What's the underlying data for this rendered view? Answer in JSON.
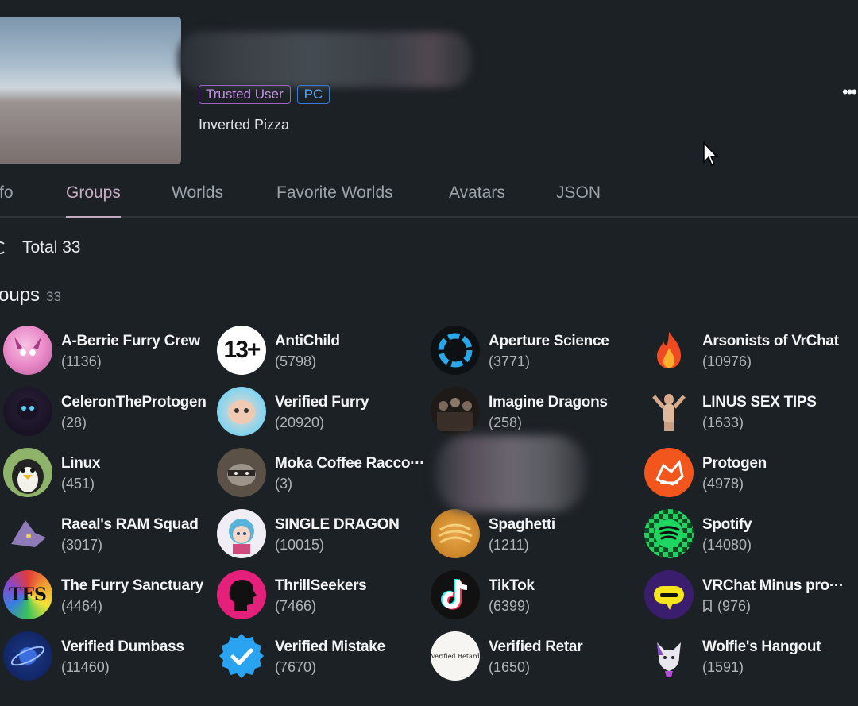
{
  "profile": {
    "badges": [
      "Trusted User",
      "PC"
    ],
    "status": "Inverted Pizza",
    "more_icon": "ellipsis-icon"
  },
  "tabs": [
    {
      "label": "Info",
      "visible": "fo"
    },
    {
      "label": "Groups",
      "visible": "Groups",
      "active": true
    },
    {
      "label": "Worlds",
      "visible": "Worlds"
    },
    {
      "label": "Favorite Worlds",
      "visible": "Favorite Worlds"
    },
    {
      "label": "Avatars",
      "visible": "Avatars"
    },
    {
      "label": "JSON",
      "visible": "JSON"
    }
  ],
  "summary": {
    "total_label": "Total 33"
  },
  "section": {
    "title": "roups",
    "count": "33"
  },
  "groups": [
    {
      "name": "A-Berrie Furry Crew",
      "count": "(1136)"
    },
    {
      "name": "AntiChild",
      "count": "(5798)"
    },
    {
      "name": "Aperture Science",
      "count": "(3771)"
    },
    {
      "name": "Arsonists of VrChat",
      "count": "(10976)"
    },
    {
      "name": "CeleronTheProtogen",
      "count": "(28)"
    },
    {
      "name": "Verified Furry",
      "count": "(20920)"
    },
    {
      "name": "Imagine Dragons",
      "count": "(258)"
    },
    {
      "name": "LINUS SEX TIPS",
      "count": "(1633)"
    },
    {
      "name": "Linux",
      "count": "(451)"
    },
    {
      "name": "Moka Coffee Racco···",
      "count": "(3)"
    },
    {
      "name": "",
      "count": ""
    },
    {
      "name": "Protogen",
      "count": "(4978)"
    },
    {
      "name": "Raeal's RAM Squad",
      "count": "(3017)"
    },
    {
      "name": "SINGLE DRAGON",
      "count": "(10015)"
    },
    {
      "name": "Spaghetti",
      "count": "(1211)"
    },
    {
      "name": "Spotify",
      "count": "(14080)"
    },
    {
      "name": "The Furry Sanctuary",
      "count": "(4464)"
    },
    {
      "name": "ThrillSeekers",
      "count": "(7466)"
    },
    {
      "name": "TikTok",
      "count": "(6399)"
    },
    {
      "name": "VRChat Minus pro···",
      "count": "(976)"
    },
    {
      "name": "Verified Dumbass",
      "count": "(11460)"
    },
    {
      "name": "Verified Mistake",
      "count": "(7670)"
    },
    {
      "name": "Verified Retar",
      "count": "(1650)"
    },
    {
      "name": "Wolfie's Hangout",
      "count": "(1591)"
    }
  ],
  "group_icons": {
    "antichild": "13+",
    "tfs": "TFS",
    "retar": "Verified Retard"
  }
}
